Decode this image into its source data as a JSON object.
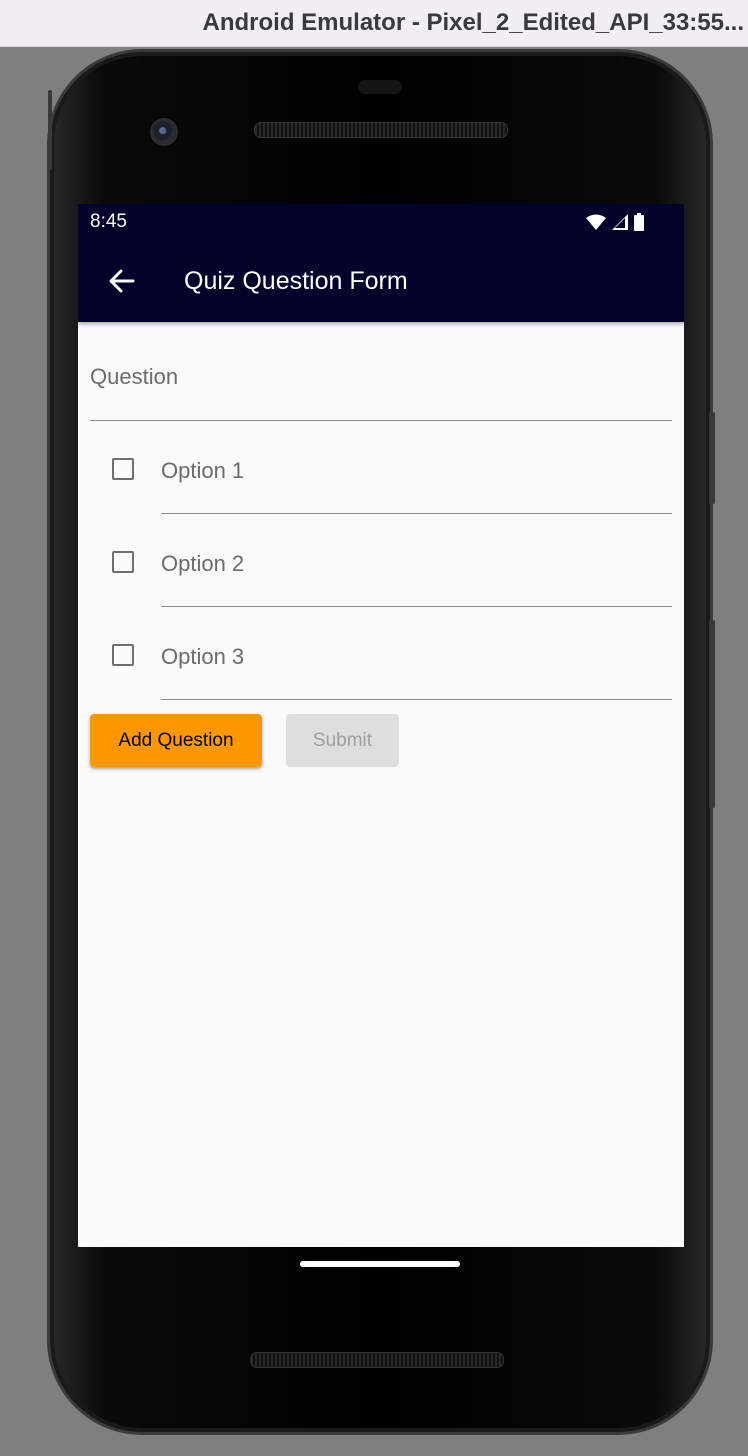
{
  "window": {
    "title": "Android Emulator - Pixel_2_Edited_API_33:55..."
  },
  "status_bar": {
    "time": "8:45",
    "icons": [
      "wifi-icon",
      "cellular-signal-icon",
      "battery-icon"
    ]
  },
  "app_bar": {
    "title": "Quiz Question Form",
    "back_icon": "arrow-back-icon",
    "background": "#02022b"
  },
  "form": {
    "question_label": "Question",
    "options": [
      {
        "label": "Option 1",
        "checked": false
      },
      {
        "label": "Option 2",
        "checked": false
      },
      {
        "label": "Option 3",
        "checked": false
      }
    ]
  },
  "buttons": {
    "add_question": {
      "label": "Add Question",
      "color": "#ff9800"
    },
    "submit": {
      "label": "Submit",
      "enabled": false
    }
  }
}
